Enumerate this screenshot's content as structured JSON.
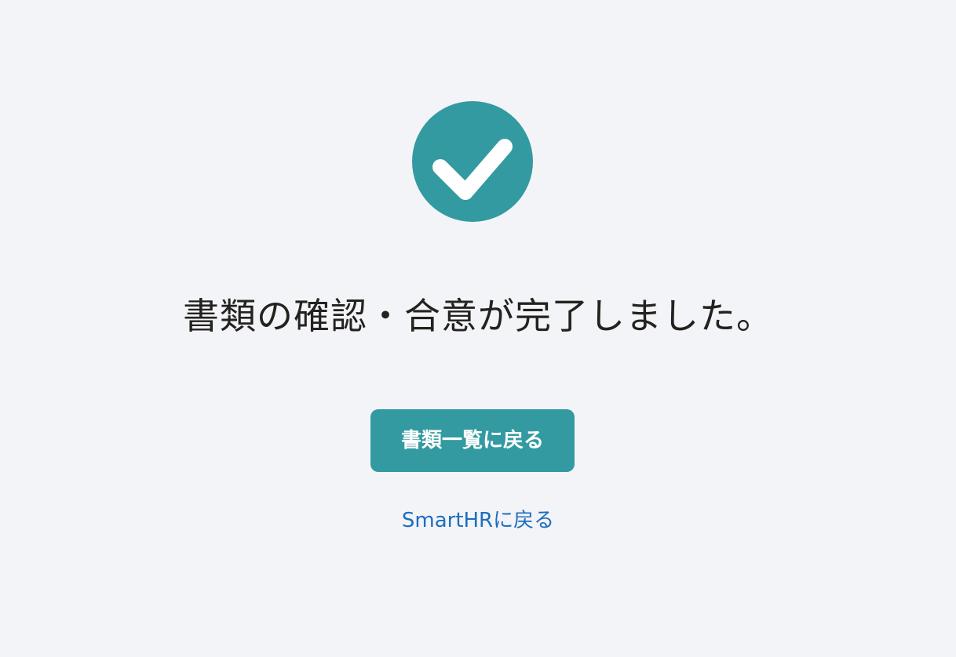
{
  "status": {
    "icon": "check-circle-icon",
    "message": "書類の確認・合意が完了しました。"
  },
  "actions": {
    "primary_button_label": "書類一覧に戻る",
    "secondary_link_label": "SmartHRに戻る"
  },
  "colors": {
    "background": "#f3f4f8",
    "accent": "#339aa1",
    "text": "#23221e",
    "link": "#1e6ebd"
  }
}
